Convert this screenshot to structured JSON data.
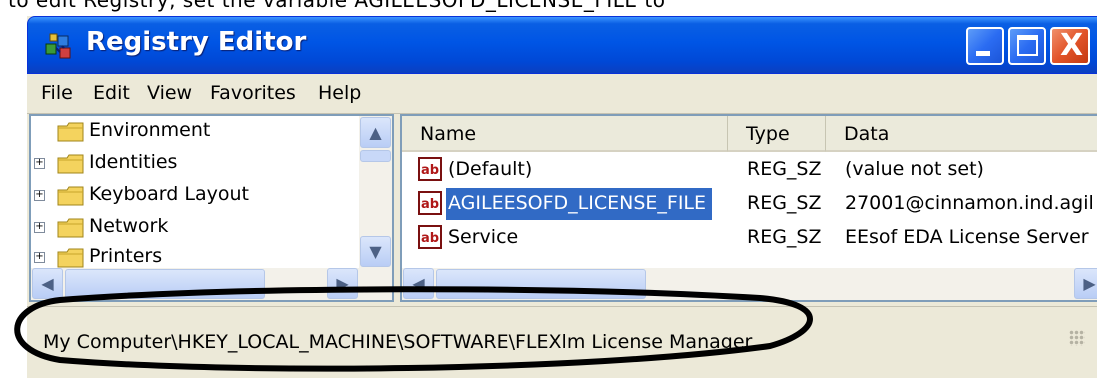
{
  "window": {
    "title": "Registry Editor",
    "controls": {
      "minimize": "_",
      "maximize": "□",
      "close": "X"
    }
  },
  "menu": {
    "items": [
      "File",
      "Edit",
      "View",
      "Favorites",
      "Help"
    ]
  },
  "tree": {
    "items": [
      {
        "label": "Environment",
        "expandable": false
      },
      {
        "label": "Identities",
        "expandable": true
      },
      {
        "label": "Keyboard Layout",
        "expandable": true
      },
      {
        "label": "Network",
        "expandable": true
      },
      {
        "label": "Printers",
        "expandable": true
      }
    ]
  },
  "list": {
    "columns": [
      "Name",
      "Type",
      "Data"
    ],
    "rows": [
      {
        "name": "(Default)",
        "type": "REG_SZ",
        "data": "(value not set)",
        "selected": false
      },
      {
        "name": "AGILEESOFD_LICENSE_FILE",
        "type": "REG_SZ",
        "data": "27001@cinnamon.ind.agil",
        "selected": true
      },
      {
        "name": "Service",
        "type": "REG_SZ",
        "data": "EEsof EDA License Server",
        "selected": false
      }
    ]
  },
  "statusbar": {
    "path": "My Computer\\HKEY_LOCAL_MACHINE\\SOFTWARE\\FLEXlm License Manager"
  },
  "colors": {
    "titlebar": "#0055e5",
    "selection": "#316ac5",
    "close_button": "#e2542a",
    "chrome": "#ece9d8",
    "annotation": "#000000"
  },
  "icons": {
    "app": "registry-editor-icon",
    "folder": "folder-icon",
    "string_value": "reg-sz-icon"
  }
}
